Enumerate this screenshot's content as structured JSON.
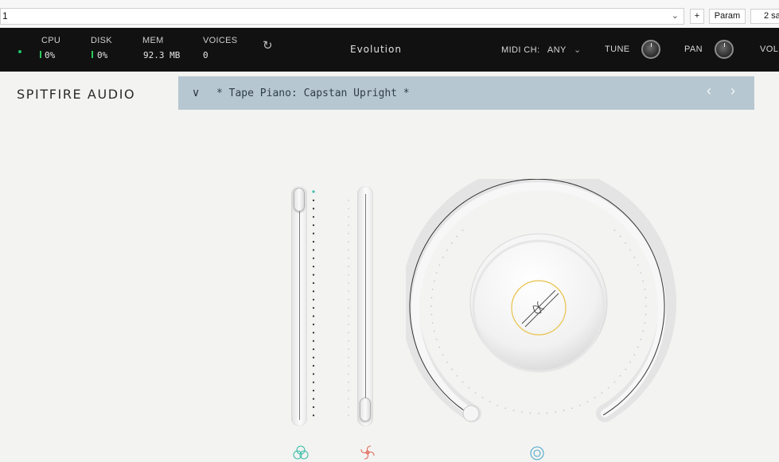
{
  "host": {
    "preset_value": "1",
    "add_label": "+",
    "param_label": "Param",
    "samples_label": "2 sa"
  },
  "status": {
    "cpu_label": "CPU",
    "cpu_value": "0%",
    "disk_label": "DISK",
    "disk_value": "0%",
    "mem_label": "MEM",
    "mem_value": "92.3 MB",
    "voices_label": "VOICES",
    "voices_value": "0",
    "plugin_title": "Evolution",
    "midi_label": "MIDI CH:",
    "midi_value": "ANY",
    "tune_label": "TUNE",
    "pan_label": "PAN",
    "vol_label": "VOL"
  },
  "plugin": {
    "brand": "SPITFIRE AUDIO",
    "patch_name": "* Tape Piano: Capstan Upright *"
  },
  "controls": {
    "left_slider_level": 1.0,
    "right_slider_level": 0.0,
    "main_dial_level": 0.0
  },
  "colors": {
    "patch_bar": "#b7c7d1",
    "meter_green": "#2ec95e",
    "dial_ring_accent": "#e8c24a",
    "icon_teal": "#3fbfa9",
    "icon_red": "#e06a5a",
    "icon_blue": "#4aa8c9"
  },
  "icons": {
    "refresh": "refresh-icon",
    "dropdown": "chevron-down-icon",
    "prev": "chevron-left-icon",
    "next": "chevron-right-icon",
    "dial_center": "tape-reel-icon",
    "bottom_left": "triad-circles-icon",
    "bottom_middle": "flower-icon",
    "bottom_right": "concentric-circles-icon"
  }
}
